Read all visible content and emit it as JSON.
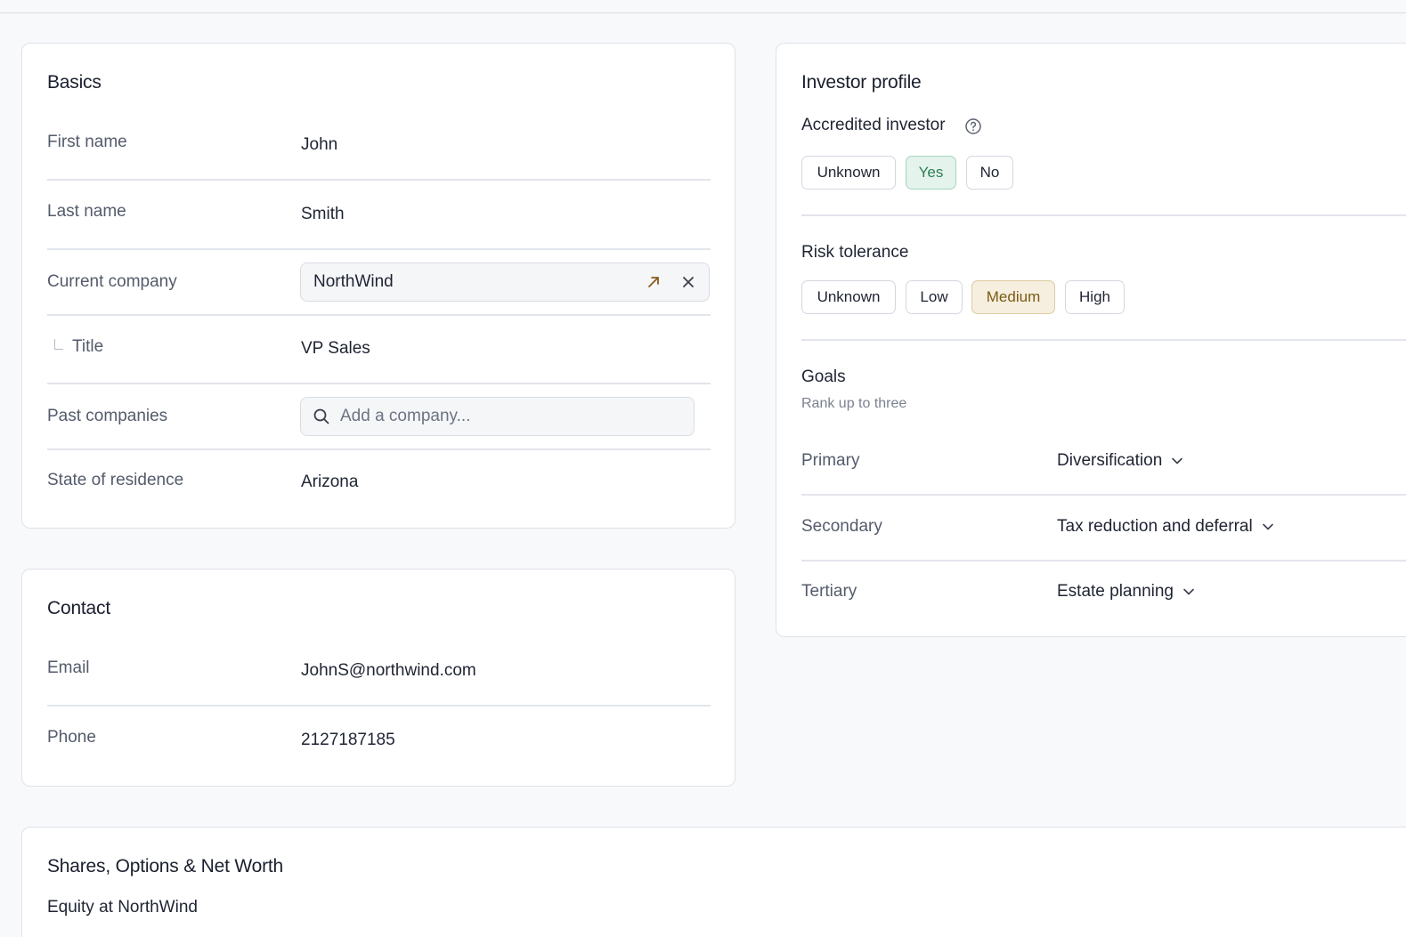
{
  "basics": {
    "title": "Basics",
    "first_name_label": "First name",
    "first_name": "John",
    "last_name_label": "Last name",
    "last_name": "Smith",
    "current_company_label": "Current company",
    "current_company": "NorthWind",
    "title_label": "Title",
    "title_value": "VP Sales",
    "past_companies_label": "Past companies",
    "past_companies_placeholder": "Add a company...",
    "state_label": "State of residence",
    "state": "Arizona"
  },
  "contact": {
    "title": "Contact",
    "email_label": "Email",
    "email": "JohnS@northwind.com",
    "phone_label": "Phone",
    "phone": "2127187185"
  },
  "investor": {
    "title": "Investor profile",
    "accredited_label": "Accredited investor",
    "accredited_options": [
      "Unknown",
      "Yes",
      "No"
    ],
    "accredited_selected": "Yes",
    "risk_label": "Risk tolerance",
    "risk_options": [
      "Unknown",
      "Low",
      "Medium",
      "High"
    ],
    "risk_selected": "Medium",
    "goals_label": "Goals",
    "goals_hint": "Rank up to three",
    "primary_label": "Primary",
    "primary_value": "Diversification",
    "secondary_label": "Secondary",
    "secondary_value": "Tax reduction and deferral",
    "tertiary_label": "Tertiary",
    "tertiary_value": "Estate planning"
  },
  "shares": {
    "title": "Shares, Options & Net Worth",
    "equity_label": "Equity at NorthWind"
  },
  "colors": {
    "selected_green_bg": "#e4f3ec",
    "selected_green_text": "#2e7d55",
    "selected_amber_bg": "#f6efdf",
    "selected_amber_text": "#7a5a12",
    "link_arrow": "#8a5a1e"
  }
}
